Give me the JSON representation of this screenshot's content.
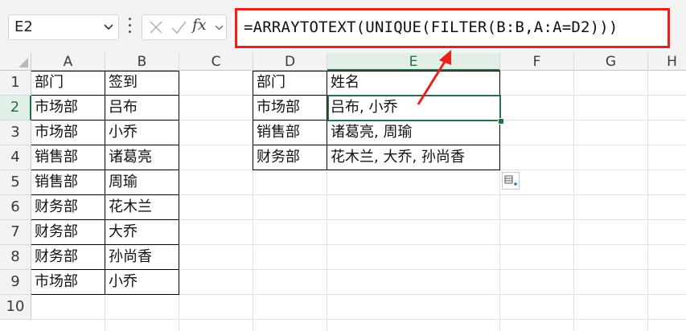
{
  "namebox": {
    "value": "E2"
  },
  "formula_bar": {
    "formula": "=ARRAYTOTEXT(UNIQUE(FILTER(B:B,A:A=D2)))",
    "fx_label": "fx"
  },
  "columns": [
    "A",
    "B",
    "C",
    "D",
    "E",
    "F",
    "G",
    "H"
  ],
  "rows": [
    "1",
    "2",
    "3",
    "4",
    "5",
    "6",
    "7",
    "8",
    "9",
    "10"
  ],
  "selected_cell": "E2",
  "source_table": {
    "headers": [
      "部门",
      "签到"
    ],
    "rows": [
      [
        "市场部",
        "吕布"
      ],
      [
        "市场部",
        "小乔"
      ],
      [
        "销售部",
        "诸葛亮"
      ],
      [
        "销售部",
        "周瑜"
      ],
      [
        "财务部",
        "花木兰"
      ],
      [
        "财务部",
        "大乔"
      ],
      [
        "财务部",
        "孙尚香"
      ],
      [
        "市场部",
        "小乔"
      ]
    ]
  },
  "result_table": {
    "headers": [
      "部门",
      "姓名"
    ],
    "rows": [
      [
        "市场部",
        "吕布, 小乔"
      ],
      [
        "销售部",
        "诸葛亮, 周瑜"
      ],
      [
        "财务部",
        "花木兰, 大乔, 孙尚香"
      ]
    ]
  },
  "colors": {
    "highlight": "#e8211c",
    "selection": "#217346"
  }
}
